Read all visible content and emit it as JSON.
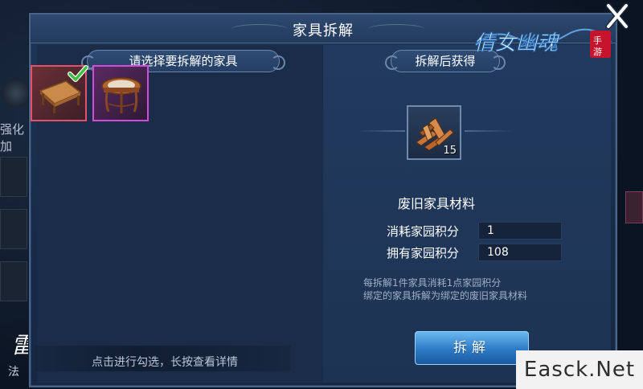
{
  "background": {
    "side_label": "强化加",
    "bottom_label": "法",
    "logo_text": "雷火"
  },
  "dialog": {
    "title": "家具拆解",
    "left_header": "请选择要拆解的家具",
    "right_header": "拆解后获得",
    "hint": "点击进行勾选，长按查看详情"
  },
  "furniture_slots": [
    {
      "name": "wooden-table",
      "selected": true,
      "border_color": "#e2506a"
    },
    {
      "name": "round-stool",
      "selected": false,
      "border_color": "#d24bd9"
    }
  ],
  "reward": {
    "item_name": "废旧家具材料",
    "count": "15",
    "icon": "wood-pile-icon"
  },
  "points": {
    "cost_label": "消耗家园积分",
    "cost_value": "1",
    "owned_label": "拥有家园积分",
    "owned_value": "108"
  },
  "notes": {
    "line1": "每拆解1件家具消耗1点家园积分",
    "line2": "绑定的家具拆解为绑定的废旧家具材料"
  },
  "decompose_button": "拆解",
  "game_logo": "倩女幽魂 手游",
  "watermark": "Easck.Net",
  "colors": {
    "accent_button": "#2c79c6",
    "panel": "#1f3656",
    "selected_border": "#e2506a",
    "purple_border": "#d24bd9"
  }
}
